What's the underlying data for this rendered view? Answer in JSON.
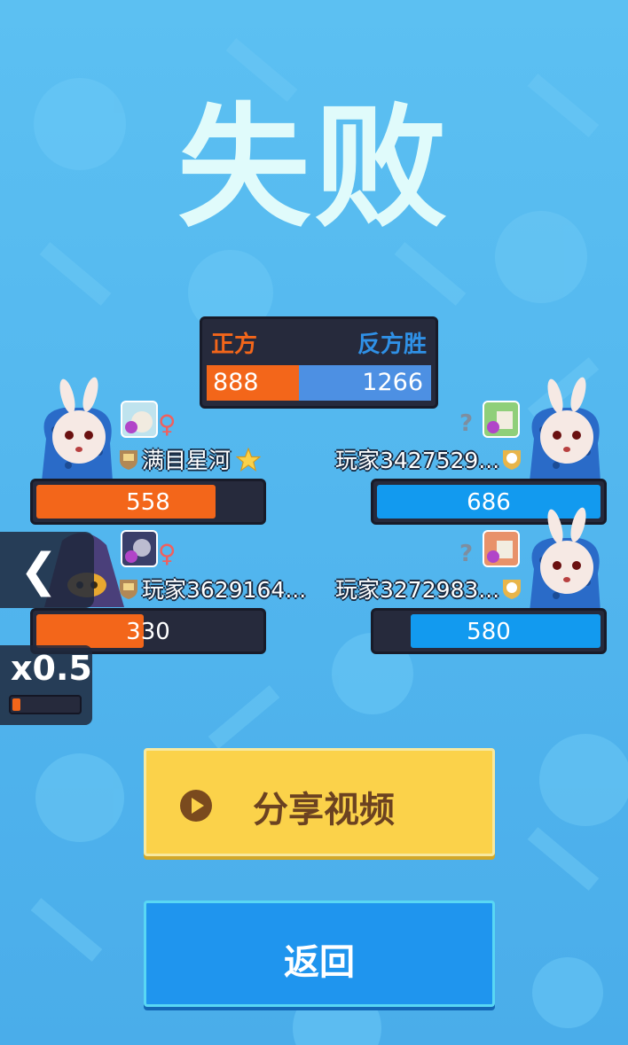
{
  "result_title": "失败",
  "scoreboard": {
    "left_label": "正方",
    "right_label": "反方胜",
    "left_score": "888",
    "right_score": "1266",
    "left_share": 0.412
  },
  "players": [
    {
      "name": "满目星河",
      "hp": "558",
      "hp_fraction": 0.8,
      "team": "left",
      "gender_symbol": "♀"
    },
    {
      "name": "玩家3427529...",
      "hp": "686",
      "hp_fraction": 1.0,
      "team": "right",
      "question_symbol": "?"
    },
    {
      "name": "玩家3629164...",
      "hp": "330",
      "hp_fraction": 0.48,
      "team": "left",
      "gender_symbol": "♀"
    },
    {
      "name": "玩家3272983...",
      "hp": "580",
      "hp_fraction": 0.85,
      "team": "right",
      "question_symbol": "?"
    }
  ],
  "speed": {
    "label": "x0.5",
    "fraction": 0.12
  },
  "buttons": {
    "share": "分享视频",
    "return": "返回"
  },
  "colors": {
    "left_team": "#f3661a",
    "right_team": "#129aef",
    "share_button": "#fbd24a",
    "return_button": "#1f95ee"
  },
  "icons": {
    "back": "chevron-left-icon",
    "share": "play-circle-icon",
    "rank_badge": "shield-badge-icon",
    "star": "star-icon"
  }
}
